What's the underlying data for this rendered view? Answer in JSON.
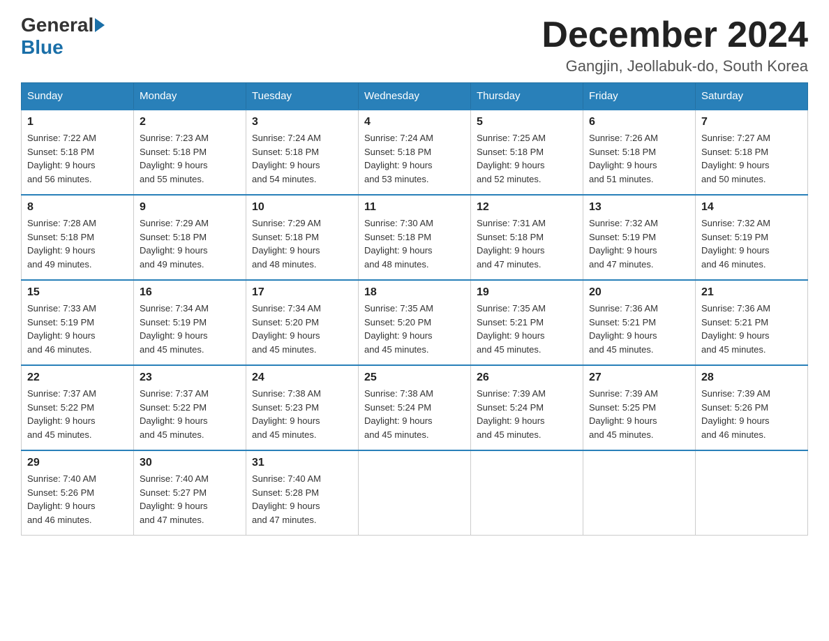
{
  "logo": {
    "general": "General",
    "blue": "Blue"
  },
  "header": {
    "title": "December 2024",
    "location": "Gangjin, Jeollabuk-do, South Korea"
  },
  "weekdays": [
    "Sunday",
    "Monday",
    "Tuesday",
    "Wednesday",
    "Thursday",
    "Friday",
    "Saturday"
  ],
  "weeks": [
    [
      {
        "day": "1",
        "sunrise": "7:22 AM",
        "sunset": "5:18 PM",
        "daylight": "9 hours and 56 minutes."
      },
      {
        "day": "2",
        "sunrise": "7:23 AM",
        "sunset": "5:18 PM",
        "daylight": "9 hours and 55 minutes."
      },
      {
        "day": "3",
        "sunrise": "7:24 AM",
        "sunset": "5:18 PM",
        "daylight": "9 hours and 54 minutes."
      },
      {
        "day": "4",
        "sunrise": "7:24 AM",
        "sunset": "5:18 PM",
        "daylight": "9 hours and 53 minutes."
      },
      {
        "day": "5",
        "sunrise": "7:25 AM",
        "sunset": "5:18 PM",
        "daylight": "9 hours and 52 minutes."
      },
      {
        "day": "6",
        "sunrise": "7:26 AM",
        "sunset": "5:18 PM",
        "daylight": "9 hours and 51 minutes."
      },
      {
        "day": "7",
        "sunrise": "7:27 AM",
        "sunset": "5:18 PM",
        "daylight": "9 hours and 50 minutes."
      }
    ],
    [
      {
        "day": "8",
        "sunrise": "7:28 AM",
        "sunset": "5:18 PM",
        "daylight": "9 hours and 49 minutes."
      },
      {
        "day": "9",
        "sunrise": "7:29 AM",
        "sunset": "5:18 PM",
        "daylight": "9 hours and 49 minutes."
      },
      {
        "day": "10",
        "sunrise": "7:29 AM",
        "sunset": "5:18 PM",
        "daylight": "9 hours and 48 minutes."
      },
      {
        "day": "11",
        "sunrise": "7:30 AM",
        "sunset": "5:18 PM",
        "daylight": "9 hours and 48 minutes."
      },
      {
        "day": "12",
        "sunrise": "7:31 AM",
        "sunset": "5:18 PM",
        "daylight": "9 hours and 47 minutes."
      },
      {
        "day": "13",
        "sunrise": "7:32 AM",
        "sunset": "5:19 PM",
        "daylight": "9 hours and 47 minutes."
      },
      {
        "day": "14",
        "sunrise": "7:32 AM",
        "sunset": "5:19 PM",
        "daylight": "9 hours and 46 minutes."
      }
    ],
    [
      {
        "day": "15",
        "sunrise": "7:33 AM",
        "sunset": "5:19 PM",
        "daylight": "9 hours and 46 minutes."
      },
      {
        "day": "16",
        "sunrise": "7:34 AM",
        "sunset": "5:19 PM",
        "daylight": "9 hours and 45 minutes."
      },
      {
        "day": "17",
        "sunrise": "7:34 AM",
        "sunset": "5:20 PM",
        "daylight": "9 hours and 45 minutes."
      },
      {
        "day": "18",
        "sunrise": "7:35 AM",
        "sunset": "5:20 PM",
        "daylight": "9 hours and 45 minutes."
      },
      {
        "day": "19",
        "sunrise": "7:35 AM",
        "sunset": "5:21 PM",
        "daylight": "9 hours and 45 minutes."
      },
      {
        "day": "20",
        "sunrise": "7:36 AM",
        "sunset": "5:21 PM",
        "daylight": "9 hours and 45 minutes."
      },
      {
        "day": "21",
        "sunrise": "7:36 AM",
        "sunset": "5:21 PM",
        "daylight": "9 hours and 45 minutes."
      }
    ],
    [
      {
        "day": "22",
        "sunrise": "7:37 AM",
        "sunset": "5:22 PM",
        "daylight": "9 hours and 45 minutes."
      },
      {
        "day": "23",
        "sunrise": "7:37 AM",
        "sunset": "5:22 PM",
        "daylight": "9 hours and 45 minutes."
      },
      {
        "day": "24",
        "sunrise": "7:38 AM",
        "sunset": "5:23 PM",
        "daylight": "9 hours and 45 minutes."
      },
      {
        "day": "25",
        "sunrise": "7:38 AM",
        "sunset": "5:24 PM",
        "daylight": "9 hours and 45 minutes."
      },
      {
        "day": "26",
        "sunrise": "7:39 AM",
        "sunset": "5:24 PM",
        "daylight": "9 hours and 45 minutes."
      },
      {
        "day": "27",
        "sunrise": "7:39 AM",
        "sunset": "5:25 PM",
        "daylight": "9 hours and 45 minutes."
      },
      {
        "day": "28",
        "sunrise": "7:39 AM",
        "sunset": "5:26 PM",
        "daylight": "9 hours and 46 minutes."
      }
    ],
    [
      {
        "day": "29",
        "sunrise": "7:40 AM",
        "sunset": "5:26 PM",
        "daylight": "9 hours and 46 minutes."
      },
      {
        "day": "30",
        "sunrise": "7:40 AM",
        "sunset": "5:27 PM",
        "daylight": "9 hours and 47 minutes."
      },
      {
        "day": "31",
        "sunrise": "7:40 AM",
        "sunset": "5:28 PM",
        "daylight": "9 hours and 47 minutes."
      },
      null,
      null,
      null,
      null
    ]
  ]
}
